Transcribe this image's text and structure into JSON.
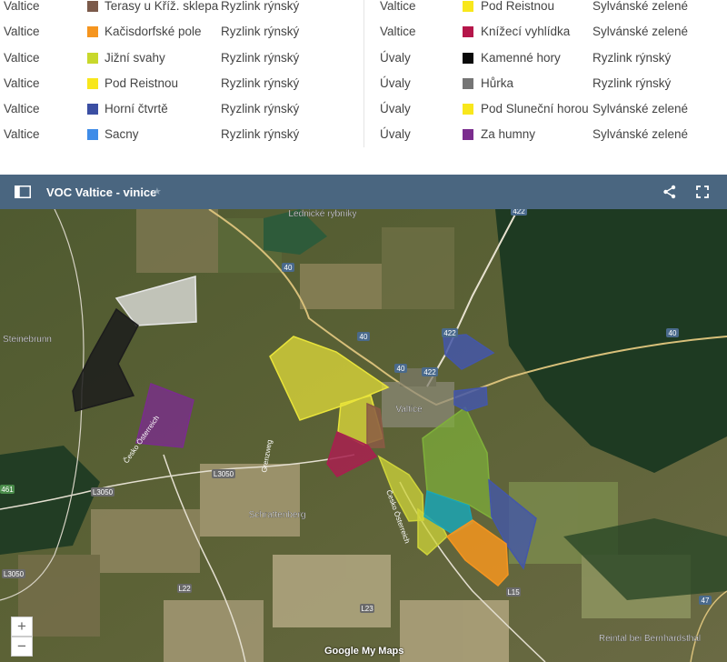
{
  "legend": {
    "left_rows": [
      {
        "village": "Valtice",
        "name": "Terasy u Kříž. sklepa",
        "variety": "Ryzlink rýnský",
        "color": "#7b5a4a"
      },
      {
        "village": "Valtice",
        "name": "Kačisdorfské pole",
        "variety": "Ryzlink rýnský",
        "color": "#f5951f"
      },
      {
        "village": "Valtice",
        "name": "Jižní svahy",
        "variety": "Ryzlink rýnský",
        "color": "#c8d82c"
      },
      {
        "village": "Valtice",
        "name": "Pod Reistnou",
        "variety": "Ryzlink rýnský",
        "color": "#f8e71c"
      },
      {
        "village": "Valtice",
        "name": "Horní čtvrtě",
        "variety": "Ryzlink rýnský",
        "color": "#3b4fa3"
      },
      {
        "village": "Valtice",
        "name": "Sacny",
        "variety": "Ryzlink rýnský",
        "color": "#3f8ce8"
      }
    ],
    "right_rows": [
      {
        "village": "Valtice",
        "name": "Pod Reistnou",
        "variety": "Sylvánské zelené",
        "color": "#f8e71c"
      },
      {
        "village": "Valtice",
        "name": "Knížecí vyhlídka",
        "variety": "Sylvánské zelené",
        "color": "#b5164a"
      },
      {
        "village": "Úvaly",
        "name": "Kamenné hory",
        "variety": "Ryzlink rýnský",
        "color": "#0a0a0a"
      },
      {
        "village": "Úvaly",
        "name": "Hůrka",
        "variety": "Ryzlink rýnský",
        "color": "#757575"
      },
      {
        "village": "Úvaly",
        "name": "Pod Sluneční horou",
        "variety": "Sylvánské zelené",
        "color": "#f8e71c"
      },
      {
        "village": "Úvaly",
        "name": "Za humny",
        "variety": "Sylvánské zelené",
        "color": "#7b2d8e"
      }
    ]
  },
  "map": {
    "title": "VOC Valtice - vinice",
    "star_icon": "★",
    "zoom_in": "+",
    "zoom_out": "−",
    "attribution": "Google My Maps",
    "place_labels": [
      "Lednické rybníky",
      "Steinebrunn",
      "Valtice",
      "Schrattenberg",
      "Reintal bei Bernhardsthal"
    ],
    "road_labels": [
      "422",
      "40",
      "40",
      "40",
      "40",
      "422",
      "422",
      "L3050",
      "L3050",
      "L22",
      "L23",
      "L15",
      "47",
      "461",
      "L3050"
    ],
    "street_labels": [
      "Česko Österreich",
      "Česko Österreich",
      "Grenzweg"
    ],
    "field_colors": {
      "plot_olive": "#cfd43a",
      "plot_green": "#7fb03a",
      "plot_teal": "#1ba5b4",
      "plot_orange": "#f5951f",
      "plot_navy": "#4457a8",
      "plot_crimson": "#a8204f",
      "plot_brown": "#8a5a44",
      "plot_black": "#1c1c1c",
      "plot_white": "#e6e6e6",
      "plot_purple": "#7a2d8c",
      "plot_yellow": "#e9e43a"
    }
  }
}
